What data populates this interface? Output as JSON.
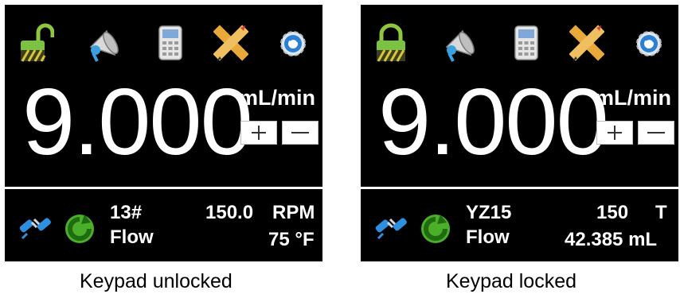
{
  "panels": [
    {
      "id": "left",
      "value": "9.000",
      "unit": "mL/min",
      "plus_label": "+",
      "minus_label": "−",
      "lock_state": "unlocked",
      "status": {
        "left_top": "13#",
        "left_bottom": "Flow",
        "right_top_value": "150.0",
        "right_top_unit": "RPM",
        "right_bottom": "75 °F"
      },
      "caption": "Keypad unlocked"
    },
    {
      "id": "right",
      "value": "9.000",
      "unit": "mL/min",
      "plus_label": "+",
      "minus_label": "−",
      "lock_state": "locked",
      "status": {
        "left_top": "YZ15",
        "left_bottom": "Flow",
        "right_top_value": "150",
        "right_top_unit": "T",
        "right_bottom": "42.385 mL"
      },
      "caption": "Keypad locked"
    }
  ],
  "icons": [
    "lock-icon",
    "megaphone-icon",
    "calculator-icon",
    "pencil-ruler-icon",
    "settings-gear-icon",
    "plug-connector-icon",
    "refresh-arrow-icon"
  ],
  "colors": {
    "background": "#000000",
    "text": "#ffffff",
    "lock_green": "#7cc242",
    "refresh_green": "#3a9a1a",
    "plug_blue": "#2e8fe0"
  }
}
